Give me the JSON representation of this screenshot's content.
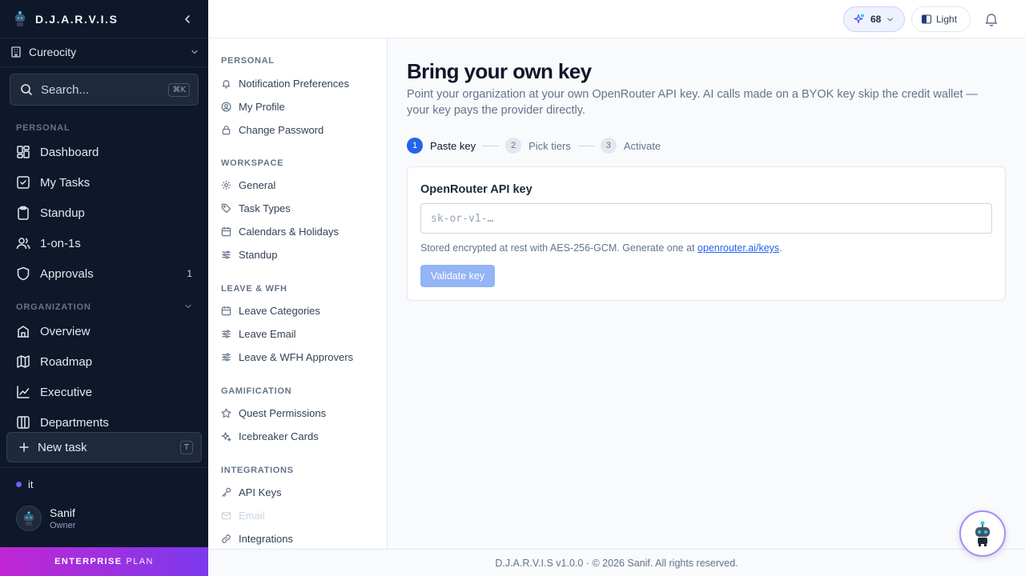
{
  "app": {
    "brand": "D.J.A.R.V.I.S"
  },
  "sidebar": {
    "org_name": "Cureocity",
    "search": {
      "placeholder": "Search...",
      "shortcut": "⌘K"
    },
    "sections": {
      "personal": "PERSONAL",
      "organization": "ORGANIZATION"
    },
    "personal_items": [
      {
        "label": "Dashboard",
        "icon": "dashboard-icon"
      },
      {
        "label": "My Tasks",
        "icon": "check-square-icon"
      },
      {
        "label": "Standup",
        "icon": "clipboard-icon"
      },
      {
        "label": "1-on-1s",
        "icon": "users-icon"
      },
      {
        "label": "Approvals",
        "icon": "shield-icon",
        "count": "1"
      }
    ],
    "organization_items": [
      {
        "label": "Overview",
        "icon": "building-icon"
      },
      {
        "label": "Roadmap",
        "icon": "map-icon"
      },
      {
        "label": "Executive",
        "icon": "line-chart-icon"
      },
      {
        "label": "Departments",
        "icon": "columns-icon"
      }
    ],
    "new_task": {
      "label": "New task",
      "shortcut": "T"
    },
    "workspace": "it",
    "user": {
      "name": "Sanif",
      "role": "Owner"
    },
    "plan": {
      "bold": "ENTERPRISE",
      "light": "PLAN"
    }
  },
  "topbar": {
    "credits": "68",
    "theme_label": "Light"
  },
  "settings_nav": {
    "sections": [
      {
        "title": "PERSONAL",
        "items": [
          {
            "label": "Notification Preferences",
            "icon": "bell-icon"
          },
          {
            "label": "My Profile",
            "icon": "user-circle-icon"
          },
          {
            "label": "Change Password",
            "icon": "lock-icon"
          }
        ]
      },
      {
        "title": "WORKSPACE",
        "items": [
          {
            "label": "General",
            "icon": "gear-icon"
          },
          {
            "label": "Task Types",
            "icon": "tag-icon"
          },
          {
            "label": "Calendars & Holidays",
            "icon": "calendar-icon"
          },
          {
            "label": "Standup",
            "icon": "sliders-icon"
          }
        ]
      },
      {
        "title": "LEAVE & WFH",
        "items": [
          {
            "label": "Leave Categories",
            "icon": "calendar-icon"
          },
          {
            "label": "Leave Email",
            "icon": "sliders-icon"
          },
          {
            "label": "Leave & WFH Approvers",
            "icon": "sliders-icon"
          }
        ]
      },
      {
        "title": "GAMIFICATION",
        "items": [
          {
            "label": "Quest Permissions",
            "icon": "star-icon"
          },
          {
            "label": "Icebreaker Cards",
            "icon": "sparkles-icon"
          }
        ]
      },
      {
        "title": "INTEGRATIONS",
        "items": [
          {
            "label": "API Keys",
            "icon": "key-icon"
          },
          {
            "label": "Email",
            "icon": "mail-icon",
            "disabled": true
          },
          {
            "label": "Integrations",
            "icon": "link-icon"
          }
        ]
      }
    ]
  },
  "main": {
    "title": "Bring your own key",
    "subtitle": "Point your organization at your own OpenRouter API key. AI calls made on a BYOK key skip the credit wallet — your key pays the provider directly.",
    "steps": [
      {
        "num": "1",
        "label": "Paste key",
        "active": true
      },
      {
        "num": "2",
        "label": "Pick tiers",
        "active": false
      },
      {
        "num": "3",
        "label": "Activate",
        "active": false
      }
    ],
    "form": {
      "label": "OpenRouter API key",
      "placeholder": "sk-or-v1-…",
      "value": "",
      "help_prefix": "Stored encrypted at rest with AES-256-GCM. Generate one at ",
      "help_link": "openrouter.ai/keys",
      "help_suffix": ".",
      "button": "Validate key"
    }
  },
  "footer": {
    "text": "D.J.A.R.V.I.S v1.0.0 · © 2026 Sanif. All rights reserved."
  },
  "colors": {
    "sidebar_bg": "#0f172a",
    "accent": "#2563eb",
    "plan_gradient_start": "#c026d3",
    "plan_gradient_end": "#7c3aed",
    "button_disabled": "#93b4f5"
  }
}
